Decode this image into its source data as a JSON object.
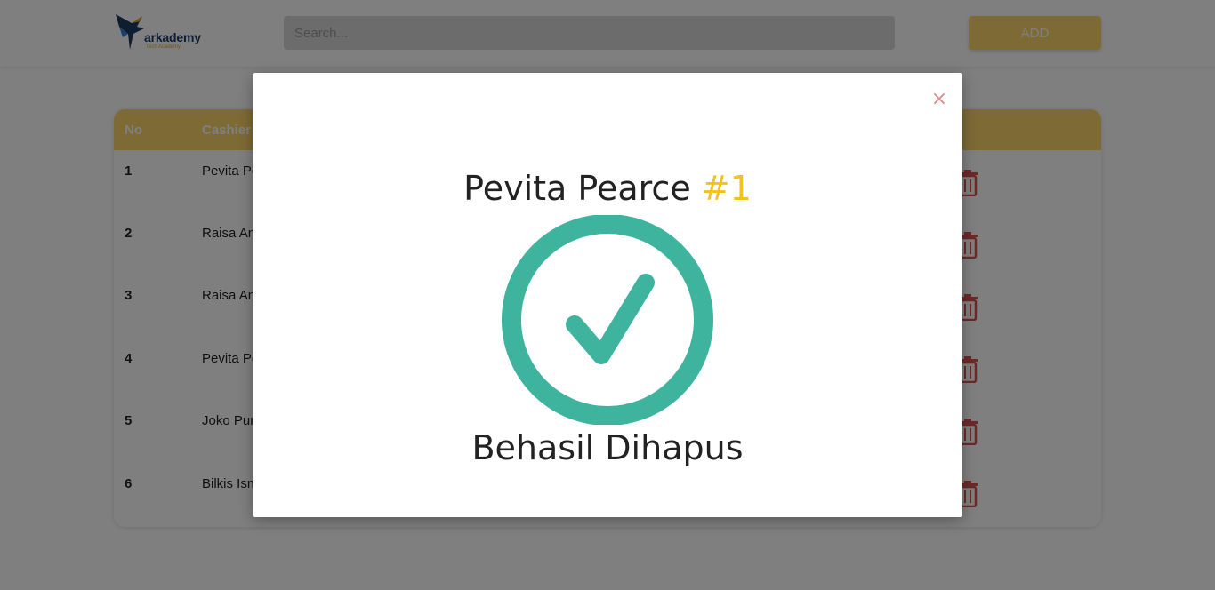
{
  "header": {
    "logo_text": "arkademy",
    "logo_sub": "Tech Academy",
    "search_placeholder": "Search...",
    "add_label": "ADD"
  },
  "table": {
    "columns": [
      "No",
      "Cashier"
    ],
    "rows": [
      {
        "no": "1",
        "name": "Pevita Pe"
      },
      {
        "no": "2",
        "name": "Raisa An"
      },
      {
        "no": "3",
        "name": "Raisa An"
      },
      {
        "no": "4",
        "name": "Pevita Pe"
      },
      {
        "no": "5",
        "name": "Joko Pur"
      },
      {
        "no": "6",
        "name": "Bilkis Ism"
      }
    ]
  },
  "modal": {
    "name": "Pevita Pearce",
    "id_label": "#1",
    "message": "Behasil Dihapus",
    "close_symbol": "×",
    "icon": "check-circle-icon"
  },
  "colors": {
    "accent": "#fbd56a",
    "success": "#3eb49f",
    "danger": "#d9534f",
    "hash": "#f5c11e"
  }
}
